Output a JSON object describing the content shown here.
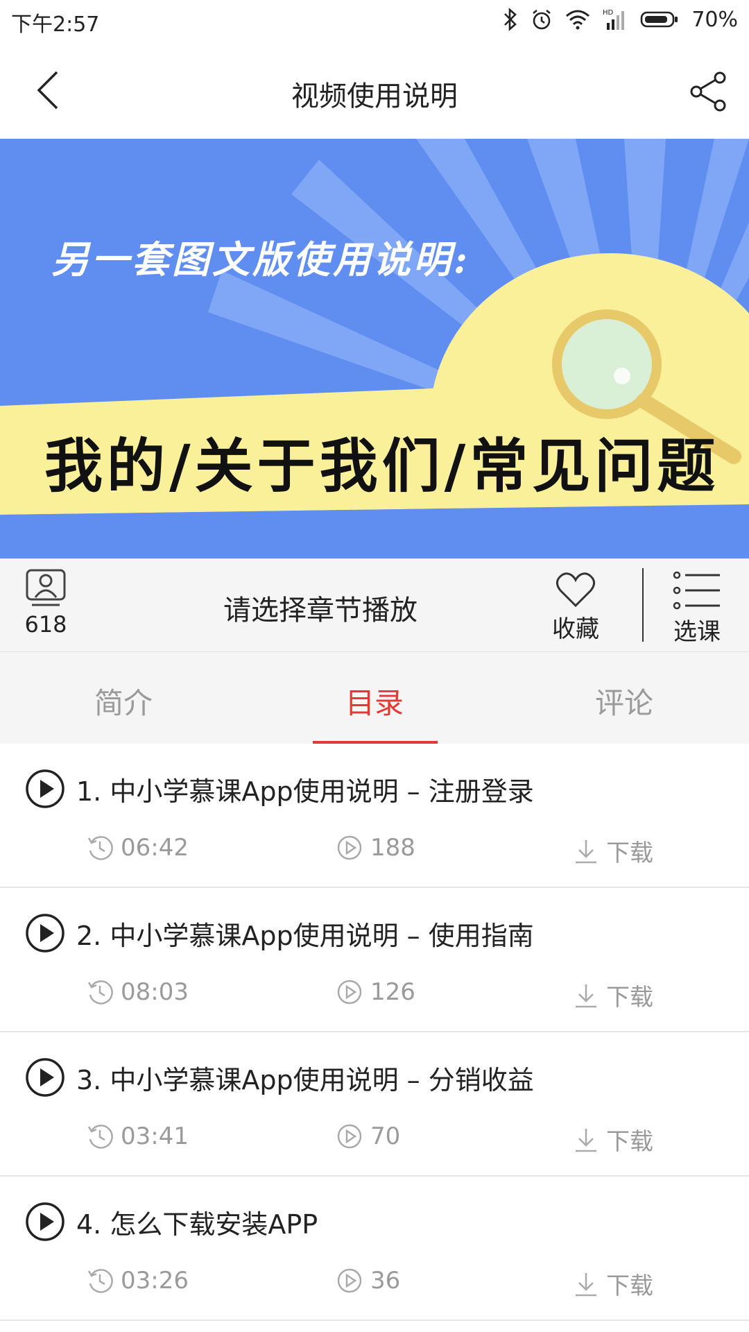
{
  "status_bar": {
    "time": "下午2:57",
    "battery": "70%"
  },
  "header": {
    "title": "视频使用说明"
  },
  "banner": {
    "text_top": "另一套图文版使用说明:",
    "text_main": "我的/关于我们/常见问题",
    "colors": {
      "sky": "#5f8ef0",
      "sun": "#fbf09a"
    }
  },
  "action_bar": {
    "viewer_count": "618",
    "prompt": "请选择章节播放",
    "favorite_label": "收藏",
    "select_label": "选课"
  },
  "tabs": [
    {
      "label": "简介",
      "active": false
    },
    {
      "label": "目录",
      "active": true
    },
    {
      "label": "评论",
      "active": false
    }
  ],
  "lessons": [
    {
      "title": "1. 中小学慕课App使用说明 – 注册登录",
      "duration": "06:42",
      "plays": "188",
      "download": "下载"
    },
    {
      "title": "2. 中小学慕课App使用说明 – 使用指南",
      "duration": "08:03",
      "plays": "126",
      "download": "下载"
    },
    {
      "title": "3. 中小学慕课App使用说明 – 分销收益",
      "duration": "03:41",
      "plays": "70",
      "download": "下载"
    },
    {
      "title": "4. 怎么下载安装APP",
      "duration": "03:26",
      "plays": "36",
      "download": "下载"
    }
  ],
  "colors": {
    "accent": "#e53935",
    "muted": "#9a9a9a"
  }
}
